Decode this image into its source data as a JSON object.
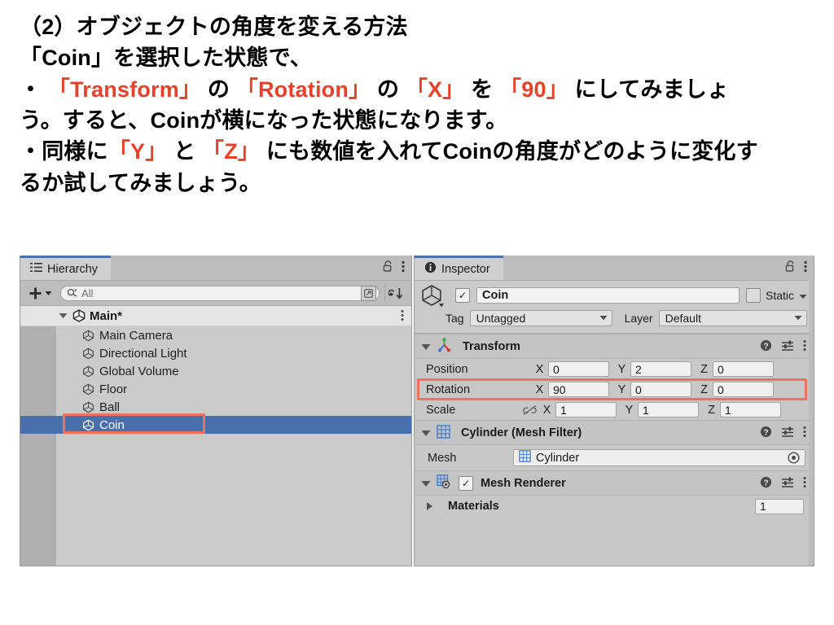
{
  "slide": {
    "lines": [
      {
        "segments": [
          {
            "t": "（2）オブジェクトの角度を変える方法",
            "c": "black"
          }
        ]
      },
      {
        "segments": [
          {
            "t": "「Coin」を選択した状態で、",
            "c": "black"
          }
        ]
      },
      {
        "segments": [
          {
            "t": "・ ",
            "c": "black"
          },
          {
            "t": "「Transform」",
            "c": "red"
          },
          {
            "t": " の ",
            "c": "black"
          },
          {
            "t": "「Rotation」",
            "c": "red"
          },
          {
            "t": " の ",
            "c": "black"
          },
          {
            "t": "「X」",
            "c": "red"
          },
          {
            "t": " を ",
            "c": "black"
          },
          {
            "t": "「90」",
            "c": "red"
          },
          {
            "t": " にしてみましょ",
            "c": "black"
          }
        ]
      },
      {
        "segments": [
          {
            "t": "う。すると、Coinが横になった状態になります。",
            "c": "black"
          }
        ]
      },
      {
        "segments": [
          {
            "t": "・同様に",
            "c": "black"
          },
          {
            "t": "「Y」",
            "c": "red"
          },
          {
            "t": " と ",
            "c": "black"
          },
          {
            "t": "「Z」",
            "c": "red"
          },
          {
            "t": " にも数値を入れてCoinの角度がどのように変化す",
            "c": "black"
          }
        ]
      },
      {
        "segments": [
          {
            "t": "るか試してみましょう。",
            "c": "black"
          }
        ]
      }
    ],
    "accent_red": "#E8412A"
  },
  "hierarchy": {
    "tab_label": "Hierarchy",
    "tab_icon": "hierarchy-icon",
    "lock_icon": "lock-icon",
    "menu_icon": "kebab-menu-icon",
    "create_label": "+",
    "search_placeholder": "All",
    "search_value": "",
    "root": {
      "label": "Main*",
      "expanded": true
    },
    "items": [
      {
        "label": "Main Camera",
        "selected": false
      },
      {
        "label": "Directional Light",
        "selected": false
      },
      {
        "label": "Global Volume",
        "selected": false
      },
      {
        "label": "Floor",
        "selected": false
      },
      {
        "label": "Ball",
        "selected": false
      },
      {
        "label": "Coin",
        "selected": true
      }
    ],
    "selection_color": "#4A6FAD",
    "highlight_color": "#F0705A"
  },
  "inspector": {
    "tab_label": "Inspector",
    "tab_icon": "info-icon",
    "lock_icon": "lock-icon",
    "menu_icon": "kebab-menu-icon",
    "object": {
      "enabled_checkmark": "✓",
      "name": "Coin",
      "static_label": "Static",
      "static_checked": false,
      "tag_label": "Tag",
      "tag_value": "Untagged",
      "layer_label": "Layer",
      "layer_value": "Default"
    },
    "components": [
      {
        "title": "Transform",
        "icon": "transform-gizmo-icon",
        "expanded": true,
        "rows": [
          {
            "name": "Position",
            "x": "0",
            "y": "2",
            "z": "0",
            "highlighted": false,
            "link_icon": false
          },
          {
            "name": "Rotation",
            "x": "90",
            "y": "0",
            "z": "0",
            "highlighted": true,
            "link_icon": false
          },
          {
            "name": "Scale",
            "x": "1",
            "y": "1",
            "z": "1",
            "highlighted": false,
            "link_icon": true
          }
        ],
        "axis_labels": {
          "x": "X",
          "y": "Y",
          "z": "Z"
        }
      },
      {
        "title": "Cylinder (Mesh Filter)",
        "icon": "mesh-filter-icon",
        "expanded": true,
        "mesh_label": "Mesh",
        "mesh_value": "Cylinder"
      },
      {
        "title": "Mesh Renderer",
        "icon": "mesh-renderer-icon",
        "expanded": true,
        "enabled_checkmark": "✓",
        "materials_label": "Materials",
        "materials_count": "1"
      }
    ],
    "header_icons": {
      "help": "help-icon",
      "preset": "preset-icon",
      "menu": "kebab-menu-icon"
    }
  }
}
